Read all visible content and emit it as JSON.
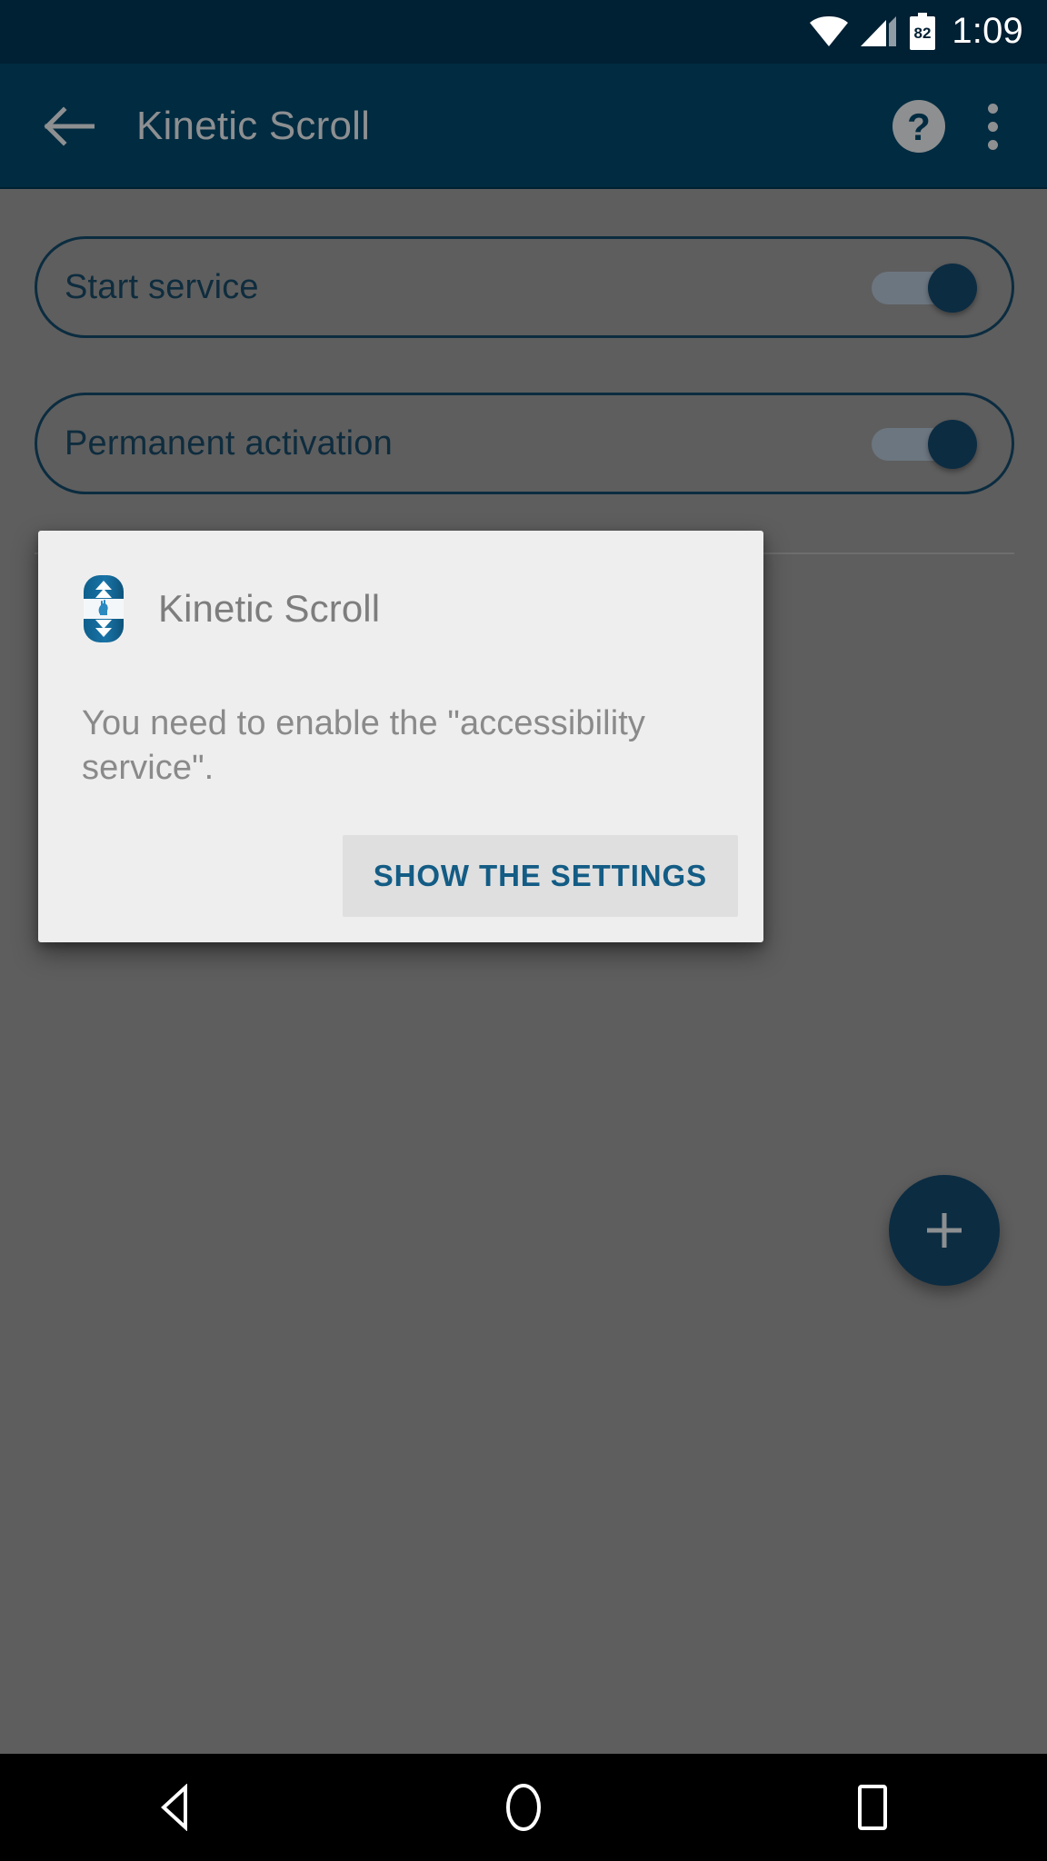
{
  "status_bar": {
    "time": "1:09",
    "battery_level": "82",
    "wifi_icon": "wifi-full-icon",
    "signal_icon": "cell-signal-icon",
    "battery_icon": "battery-icon",
    "background_color": "#002033"
  },
  "app_bar": {
    "back_icon": "back-arrow-icon",
    "title": "Kinetic Scroll",
    "help_icon": "help-circle-icon",
    "overflow_icon": "overflow-menu-icon",
    "background_color": "#002b40",
    "title_color": "#8d8f91"
  },
  "content": {
    "scrim_color": "#5e5e5e",
    "preferences": [
      {
        "label": "Start service",
        "toggle_state": "on"
      },
      {
        "label": "Permanent activation",
        "toggle_state": "on"
      }
    ],
    "fab": {
      "icon": "plus-icon",
      "color": "#0c2c42"
    }
  },
  "dialog": {
    "app_icon": "kinetic-scroll-app-icon",
    "title": "Kinetic Scroll",
    "message": "You need to enable the \"accessibility service\".",
    "primary_action": "SHOW THE SETTINGS",
    "background_color": "#eeeeee",
    "action_text_color": "#135c85"
  },
  "nav_bar": {
    "back_icon": "nav-back-triangle-icon",
    "home_icon": "nav-home-circle-icon",
    "recents_icon": "nav-recents-square-icon",
    "background_color": "#000000"
  }
}
